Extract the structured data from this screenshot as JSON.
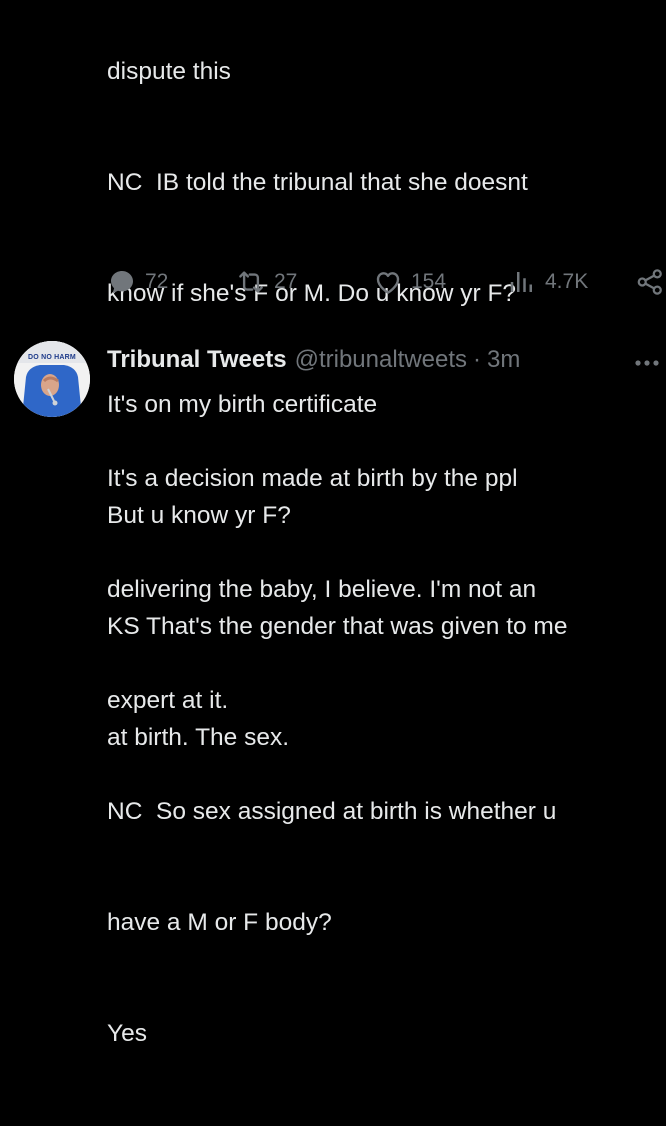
{
  "colors": {
    "background": "#000000",
    "text": "#e7e9ea",
    "secondary": "#71767b"
  },
  "tweet1": {
    "text_lines": [
      "dispute this",
      "NC  IB told the tribunal that she doesnt",
      "know if she's F or M. Do u know yr F?",
      "It's on my birth certificate",
      "But u know yr F?",
      "KS That's the gender that was given to me",
      "at birth. The sex."
    ],
    "actions": {
      "replies": "72",
      "retweets": "27",
      "likes": "154",
      "views": "4.7K"
    }
  },
  "tweet2": {
    "avatar_caption": "DO NO HARM",
    "display_name": "Tribunal Tweets",
    "handle": "@tribunaltweets",
    "separator": "·",
    "time": "3m",
    "more_icon": "more-dots-icon",
    "text_lines": [
      "It's a decision made at birth by the ppl",
      "delivering the baby, I believe. I'm not an",
      "expert at it.",
      "NC  So sex assigned at birth is whether u",
      "have a M or F body?",
      "Yes"
    ]
  }
}
